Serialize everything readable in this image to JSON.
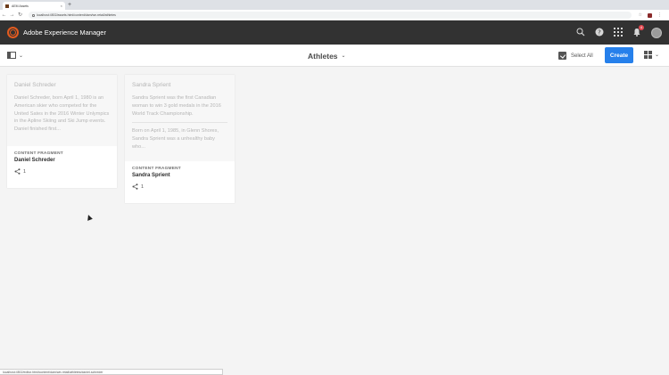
{
  "browser": {
    "tab_title": "AEM Assets",
    "url": "localhost:4502/assets.html/content/dam/we-retail/athletes",
    "status_url": "localhost:4502/editor.html/content/dam/we-retail/athletes/daniel-schreder"
  },
  "shell": {
    "brand": "Adobe Experience Manager",
    "notification_count": "4"
  },
  "actionbar": {
    "title": "Athletes",
    "select_all": "Select All",
    "create": "Create"
  },
  "cards": [
    {
      "name": "Daniel Schreder",
      "paragraphs": [
        "Daniel Schreder, born April 1, 1980 is an American skier who competed for the United Sates in the 2016 Winter Unlympics in the Apline Skiing and Ski Jump events. Daniel finished first..."
      ],
      "type": "CONTENT FRAGMENT",
      "title": "Daniel Schreder",
      "references": "1"
    },
    {
      "name": "Sandra Sprient",
      "paragraphs": [
        "Sandra Sprient was the first Canadian woman to win 3 gold medals in the 2016 World Track Championship.",
        "Born on April 1, 1985, in Glenn Shores, Sandra Sprient was a unhealthy baby who..."
      ],
      "type": "CONTENT FRAGMENT",
      "title": "Sandra Sprient",
      "references": "1"
    }
  ],
  "colors": {
    "shell_bg": "#323232",
    "accent": "#2680eb",
    "logo": "#e35b1f",
    "badge": "#e34850"
  }
}
